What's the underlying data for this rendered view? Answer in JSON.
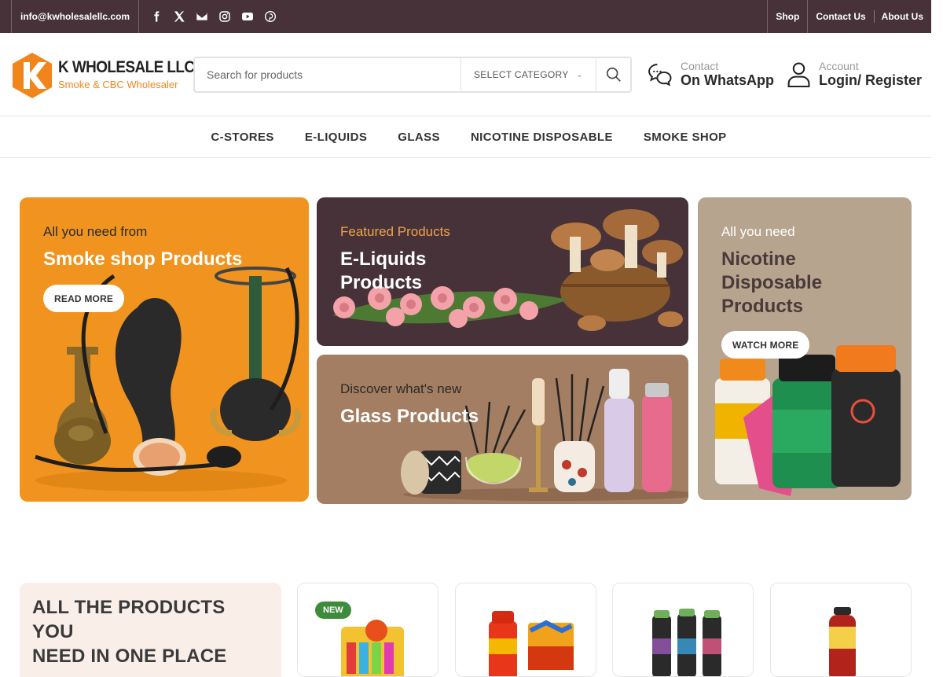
{
  "topbar": {
    "email": "info@kwholesalellc.com",
    "socials": [
      "facebook-icon",
      "x-icon",
      "email-icon",
      "instagram-icon",
      "youtube-icon",
      "pinterest-icon"
    ],
    "links": [
      "Shop",
      "Contact Us",
      "About Us"
    ]
  },
  "header": {
    "logo_name": "K WHOLESALE LLC",
    "logo_tagline": "Smoke & CBC Wholesaler",
    "search_placeholder": "Search for products",
    "category_label": "SELECT CATEGORY",
    "contact_small": "Contact",
    "contact_big": "On WhatsApp",
    "account_small": "Account",
    "account_big": "Login/ Register"
  },
  "nav": {
    "items": [
      "C-STORES",
      "E-LIQUIDS",
      "GLASS",
      "NICOTINE DISPOSABLE",
      "SMOKE SHOP"
    ]
  },
  "banners": {
    "smoke": {
      "subtitle": "All you need from",
      "title": "Smoke shop Products",
      "button": "READ MORE"
    },
    "eliquids": {
      "subtitle": "Featured Products",
      "title_line1": "E-Liquids",
      "title_line2": "Products"
    },
    "glass": {
      "subtitle": "Discover what's new",
      "title": "Glass Products"
    },
    "nicotine": {
      "subtitle": "All you need",
      "title_line1": "Nicotine",
      "title_line2": "Disposable",
      "title_line3": "Products",
      "button": "WATCH MORE"
    }
  },
  "section": {
    "heading_line1": "ALL THE PRODUCTS YOU",
    "heading_line2": "NEED IN ONE PLACE",
    "badge_new": "NEW"
  },
  "colors": {
    "topbar_bg": "#463238",
    "brand_orange": "#f0941f",
    "eliquid_bg": "#463238",
    "glass_bg": "#a47e62",
    "nicotine_bg": "#b6a48e",
    "badge_green": "#3f8b3c"
  }
}
